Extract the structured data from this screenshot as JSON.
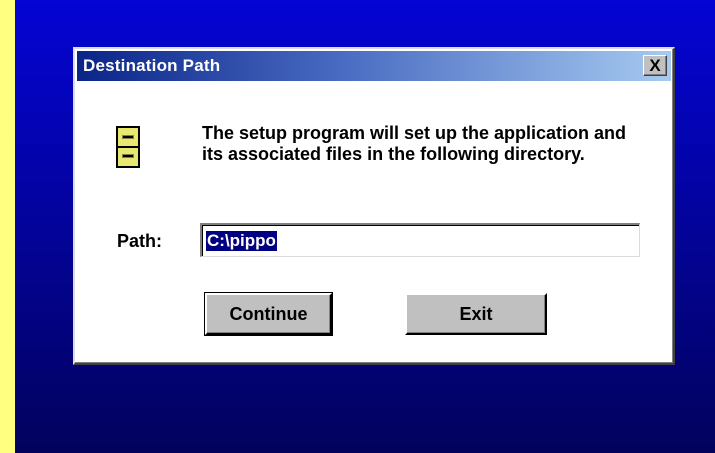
{
  "dialog": {
    "title": "Destination Path",
    "close_label": "X",
    "message": "The setup program will set up the application and its associated files in the following directory.",
    "path_label": "Path:",
    "path_value": "C:\\pippo",
    "continue_label": "Continue",
    "exit_label": "Exit"
  },
  "colors": {
    "desktop_background": "#0404d4",
    "titlebar_active": "#0a2488",
    "selection": "#000080",
    "icon_fill": "#e8e870"
  },
  "icons": {
    "dialog_icon": "file-cabinet-icon"
  }
}
